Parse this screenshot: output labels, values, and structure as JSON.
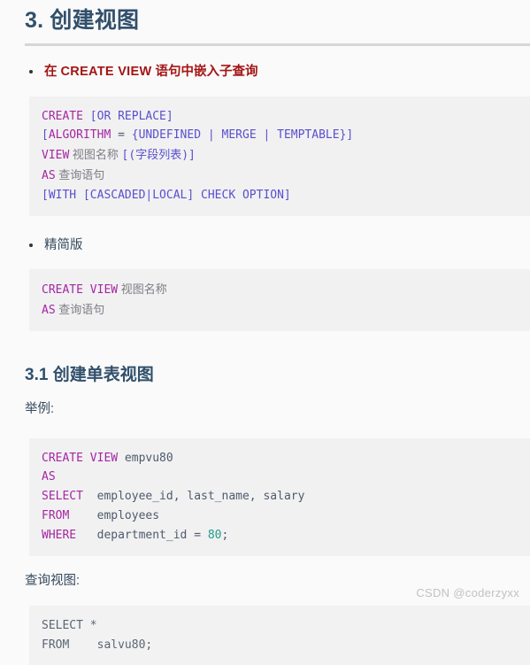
{
  "document": {
    "heading": "3. 创建视图",
    "watermark": "CSDN @coderzyxx"
  },
  "section_full_syntax": {
    "bullet_label_prefix": "在 ",
    "bullet_label_code": "CREATE VIEW",
    "bullet_label_suffix": " 语句中嵌入子查询",
    "code": {
      "line1_kw": "CREATE",
      "line1_brk": " [OR REPLACE]",
      "line2_brk_open": "[",
      "line2_kw": "ALGORITHM",
      "line2_eq": " = ",
      "line2_body": "{UNDEFINED | MERGE | TEMPTABLE}]",
      "line3_kw": "VIEW",
      "line3_cjk": " 视图名称 ",
      "line3_brk": "[(字段列表)]",
      "line4_kw": "AS",
      "line4_cjk": " 查询语句",
      "line5_brk": "[WITH [CASCADED|LOCAL] CHECK OPTION]"
    }
  },
  "section_simple_syntax": {
    "bullet_label": "精简版",
    "code": {
      "line1_kw": "CREATE VIEW",
      "line1_cjk": " 视图名称",
      "line2_kw": "AS",
      "line2_cjk": " 查询语句"
    }
  },
  "section_single_table": {
    "heading": "3.1 创建单表视图",
    "example_label": "举例:",
    "code": {
      "line1_kw": "CREATE VIEW",
      "line1_idn": " empvu80",
      "line2_kw": "AS",
      "line3_kw": "SELECT",
      "line3_idn": "  employee_id, last_name, salary",
      "line4_kw": "FROM",
      "line4_idn": "    employees",
      "line5_kw": "WHERE",
      "line5_idn": "   department_id = ",
      "line5_num": "80",
      "line5_pun": ";"
    },
    "query_label": "查询视图:",
    "query_code": {
      "line1": "SELECT *",
      "line2": "FROM    salvu80;"
    }
  },
  "colors": {
    "heading": "#31506b",
    "bullet_highlight": "#a41515",
    "keyword": "#a626a4",
    "bracket": "#5a4fcf",
    "number": "#1f9e8c",
    "identifier": "#4f5b6e",
    "code_background": "#f1f1f1",
    "page_background": "#fafafa",
    "watermark": "#c2c2c2"
  }
}
